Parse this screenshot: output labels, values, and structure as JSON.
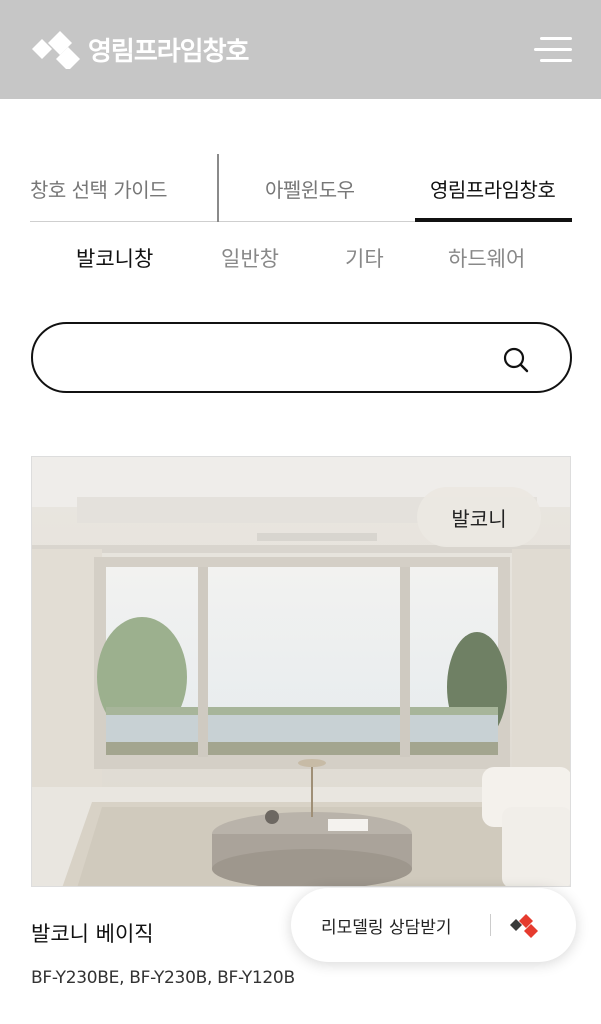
{
  "header": {
    "brand_name": "영림프라임창호",
    "menu_icon": "hamburger-menu-icon"
  },
  "tabs": [
    {
      "label": "창호 선택 가이드"
    },
    {
      "label": "아펠윈도우"
    },
    {
      "label": "영림프라임창호",
      "active": true
    }
  ],
  "subnav": [
    {
      "label": "발코니창",
      "active": true
    },
    {
      "label": "일반창"
    },
    {
      "label": "기타"
    },
    {
      "label": "하드웨어"
    }
  ],
  "search": {
    "value": "",
    "placeholder": "",
    "icon": "search-icon"
  },
  "product": {
    "badge": "발코니",
    "title": "발코니 베이직",
    "models": "BF-Y230BE, BF-Y230B, BF-Y120B"
  },
  "consult_button": {
    "label": "리모델링 상담받기",
    "icon": "brand-logo-icon"
  },
  "colors": {
    "header_bg": "#c6c6c6",
    "accent_red": "#e63b2e",
    "text_dark": "#111111",
    "text_muted": "#888888"
  }
}
